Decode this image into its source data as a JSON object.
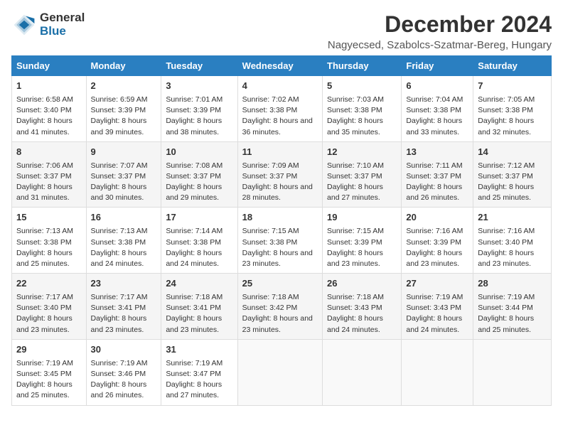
{
  "header": {
    "logo_line1": "General",
    "logo_line2": "Blue",
    "title": "December 2024",
    "subtitle": "Nagyecsed, Szabolcs-Szatmar-Bereg, Hungary"
  },
  "columns": [
    "Sunday",
    "Monday",
    "Tuesday",
    "Wednesday",
    "Thursday",
    "Friday",
    "Saturday"
  ],
  "weeks": [
    [
      {
        "day": "1",
        "sunrise": "Sunrise: 6:58 AM",
        "sunset": "Sunset: 3:40 PM",
        "daylight": "Daylight: 8 hours and 41 minutes."
      },
      {
        "day": "2",
        "sunrise": "Sunrise: 6:59 AM",
        "sunset": "Sunset: 3:39 PM",
        "daylight": "Daylight: 8 hours and 39 minutes."
      },
      {
        "day": "3",
        "sunrise": "Sunrise: 7:01 AM",
        "sunset": "Sunset: 3:39 PM",
        "daylight": "Daylight: 8 hours and 38 minutes."
      },
      {
        "day": "4",
        "sunrise": "Sunrise: 7:02 AM",
        "sunset": "Sunset: 3:38 PM",
        "daylight": "Daylight: 8 hours and 36 minutes."
      },
      {
        "day": "5",
        "sunrise": "Sunrise: 7:03 AM",
        "sunset": "Sunset: 3:38 PM",
        "daylight": "Daylight: 8 hours and 35 minutes."
      },
      {
        "day": "6",
        "sunrise": "Sunrise: 7:04 AM",
        "sunset": "Sunset: 3:38 PM",
        "daylight": "Daylight: 8 hours and 33 minutes."
      },
      {
        "day": "7",
        "sunrise": "Sunrise: 7:05 AM",
        "sunset": "Sunset: 3:38 PM",
        "daylight": "Daylight: 8 hours and 32 minutes."
      }
    ],
    [
      {
        "day": "8",
        "sunrise": "Sunrise: 7:06 AM",
        "sunset": "Sunset: 3:37 PM",
        "daylight": "Daylight: 8 hours and 31 minutes."
      },
      {
        "day": "9",
        "sunrise": "Sunrise: 7:07 AM",
        "sunset": "Sunset: 3:37 PM",
        "daylight": "Daylight: 8 hours and 30 minutes."
      },
      {
        "day": "10",
        "sunrise": "Sunrise: 7:08 AM",
        "sunset": "Sunset: 3:37 PM",
        "daylight": "Daylight: 8 hours and 29 minutes."
      },
      {
        "day": "11",
        "sunrise": "Sunrise: 7:09 AM",
        "sunset": "Sunset: 3:37 PM",
        "daylight": "Daylight: 8 hours and 28 minutes."
      },
      {
        "day": "12",
        "sunrise": "Sunrise: 7:10 AM",
        "sunset": "Sunset: 3:37 PM",
        "daylight": "Daylight: 8 hours and 27 minutes."
      },
      {
        "day": "13",
        "sunrise": "Sunrise: 7:11 AM",
        "sunset": "Sunset: 3:37 PM",
        "daylight": "Daylight: 8 hours and 26 minutes."
      },
      {
        "day": "14",
        "sunrise": "Sunrise: 7:12 AM",
        "sunset": "Sunset: 3:37 PM",
        "daylight": "Daylight: 8 hours and 25 minutes."
      }
    ],
    [
      {
        "day": "15",
        "sunrise": "Sunrise: 7:13 AM",
        "sunset": "Sunset: 3:38 PM",
        "daylight": "Daylight: 8 hours and 25 minutes."
      },
      {
        "day": "16",
        "sunrise": "Sunrise: 7:13 AM",
        "sunset": "Sunset: 3:38 PM",
        "daylight": "Daylight: 8 hours and 24 minutes."
      },
      {
        "day": "17",
        "sunrise": "Sunrise: 7:14 AM",
        "sunset": "Sunset: 3:38 PM",
        "daylight": "Daylight: 8 hours and 24 minutes."
      },
      {
        "day": "18",
        "sunrise": "Sunrise: 7:15 AM",
        "sunset": "Sunset: 3:38 PM",
        "daylight": "Daylight: 8 hours and 23 minutes."
      },
      {
        "day": "19",
        "sunrise": "Sunrise: 7:15 AM",
        "sunset": "Sunset: 3:39 PM",
        "daylight": "Daylight: 8 hours and 23 minutes."
      },
      {
        "day": "20",
        "sunrise": "Sunrise: 7:16 AM",
        "sunset": "Sunset: 3:39 PM",
        "daylight": "Daylight: 8 hours and 23 minutes."
      },
      {
        "day": "21",
        "sunrise": "Sunrise: 7:16 AM",
        "sunset": "Sunset: 3:40 PM",
        "daylight": "Daylight: 8 hours and 23 minutes."
      }
    ],
    [
      {
        "day": "22",
        "sunrise": "Sunrise: 7:17 AM",
        "sunset": "Sunset: 3:40 PM",
        "daylight": "Daylight: 8 hours and 23 minutes."
      },
      {
        "day": "23",
        "sunrise": "Sunrise: 7:17 AM",
        "sunset": "Sunset: 3:41 PM",
        "daylight": "Daylight: 8 hours and 23 minutes."
      },
      {
        "day": "24",
        "sunrise": "Sunrise: 7:18 AM",
        "sunset": "Sunset: 3:41 PM",
        "daylight": "Daylight: 8 hours and 23 minutes."
      },
      {
        "day": "25",
        "sunrise": "Sunrise: 7:18 AM",
        "sunset": "Sunset: 3:42 PM",
        "daylight": "Daylight: 8 hours and 23 minutes."
      },
      {
        "day": "26",
        "sunrise": "Sunrise: 7:18 AM",
        "sunset": "Sunset: 3:43 PM",
        "daylight": "Daylight: 8 hours and 24 minutes."
      },
      {
        "day": "27",
        "sunrise": "Sunrise: 7:19 AM",
        "sunset": "Sunset: 3:43 PM",
        "daylight": "Daylight: 8 hours and 24 minutes."
      },
      {
        "day": "28",
        "sunrise": "Sunrise: 7:19 AM",
        "sunset": "Sunset: 3:44 PM",
        "daylight": "Daylight: 8 hours and 25 minutes."
      }
    ],
    [
      {
        "day": "29",
        "sunrise": "Sunrise: 7:19 AM",
        "sunset": "Sunset: 3:45 PM",
        "daylight": "Daylight: 8 hours and 25 minutes."
      },
      {
        "day": "30",
        "sunrise": "Sunrise: 7:19 AM",
        "sunset": "Sunset: 3:46 PM",
        "daylight": "Daylight: 8 hours and 26 minutes."
      },
      {
        "day": "31",
        "sunrise": "Sunrise: 7:19 AM",
        "sunset": "Sunset: 3:47 PM",
        "daylight": "Daylight: 8 hours and 27 minutes."
      },
      null,
      null,
      null,
      null
    ]
  ]
}
